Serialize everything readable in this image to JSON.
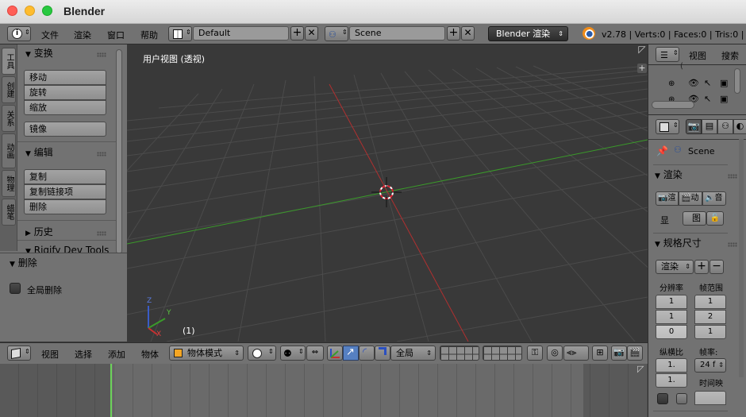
{
  "window": {
    "title": "Blender"
  },
  "info_header": {
    "menus": [
      "文件",
      "渲染",
      "窗口",
      "帮助"
    ],
    "layout_name": "Default",
    "scene_name": "Scene",
    "engine": "Blender 渲染",
    "stats": "v2.78 | Verts:0 | Faces:0 | Tris:0 | Ob"
  },
  "tool_tabs": [
    "工具",
    "创建",
    "关系",
    "动画",
    "物理",
    "蜡笔"
  ],
  "tool_panel": {
    "transform_header": "变换",
    "transform_buttons": [
      "移动",
      "旋转",
      "缩放"
    ],
    "mirror_button": "镜像",
    "edit_header": "编辑",
    "edit_buttons": [
      "复制",
      "复制链接项",
      "删除"
    ],
    "history_header": "历史",
    "rigify_header": "Rigify Dev Tools",
    "delete_header": "删除",
    "global_delete_label": "全局删除"
  },
  "viewport": {
    "title": "用户视图 (透视)",
    "frame_label": "(1)",
    "axis_z": "Z",
    "axis_y": "Y",
    "axis_x": "X"
  },
  "view3d_header": {
    "menus": [
      "视图",
      "选择",
      "添加",
      "物体"
    ],
    "mode": "物体模式",
    "orientation": "全局"
  },
  "outliner": {
    "menus": [
      "视图",
      "搜索"
    ]
  },
  "properties": {
    "scene_label": "Scene",
    "render_header": "渲染",
    "render_btn1": "渲",
    "render_btn2": "动",
    "render_btn3": "音",
    "display_label": "显",
    "display_value": "图",
    "dimensions_header": "规格尺寸",
    "preset_label": "渲染",
    "resolution_label": "分辨率",
    "frame_range_label": "帧范围",
    "res_values": [
      "1",
      "1",
      "0"
    ],
    "frame_values": [
      "1",
      "2",
      "1"
    ],
    "aspect_label": "纵横比",
    "framerate_label": "帧率:",
    "aspect_values": [
      "1.",
      "1."
    ],
    "fps_value": "24 f",
    "time_remap_label": "时间映"
  },
  "colors": {
    "accent_orange": "#f5a623",
    "x_axis": "#b03030",
    "y_axis": "#3a9a2a",
    "selected_blue": "#5680c2"
  }
}
